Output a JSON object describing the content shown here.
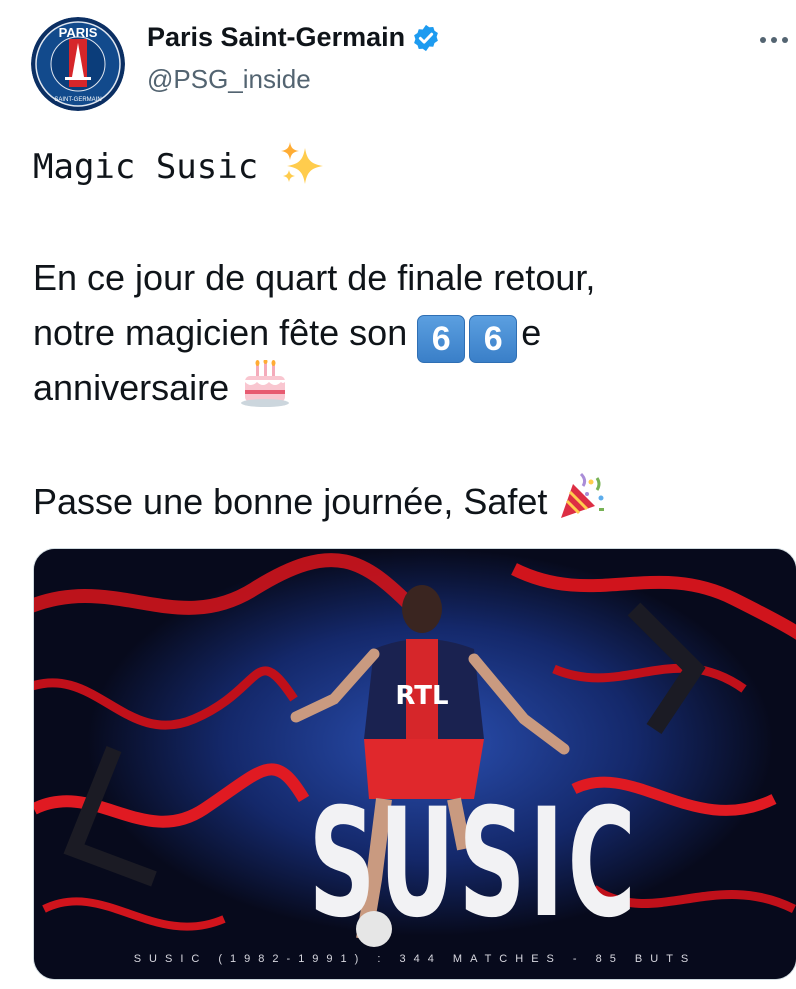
{
  "author": {
    "display_name": "Paris Saint-Germain",
    "handle": "@PSG_inside",
    "verified": true,
    "avatar_text_top": "PARIS",
    "avatar_text_bottom": "SAINT-GERMAIN"
  },
  "menu": {
    "more_label": "•••"
  },
  "tweet": {
    "line1": "Magic Susic",
    "line2": "En ce jour de quart de finale retour,",
    "line3_prefix": "notre magicien fête son",
    "line3_digit_a": "6",
    "line3_digit_b": "6",
    "line3_suffix": "e",
    "line4": "anniversaire",
    "line5": "Passe une bonne journée, Safet"
  },
  "media": {
    "big_title": "SUSIC",
    "shirt_text": "RTL",
    "caption": "SUSIC (1982-1991) : 344 MATCHES - 85 BUTS"
  },
  "icons": {
    "verified": "verified-badge-icon",
    "sparkles": "sparkles-icon",
    "cake": "birthday-cake-icon",
    "party": "party-popper-icon"
  },
  "colors": {
    "text": "#0f1419",
    "secondary": "#536471",
    "verified_blue": "#1d9bf0",
    "psg_navy": "#004170",
    "psg_red": "#da291c"
  }
}
